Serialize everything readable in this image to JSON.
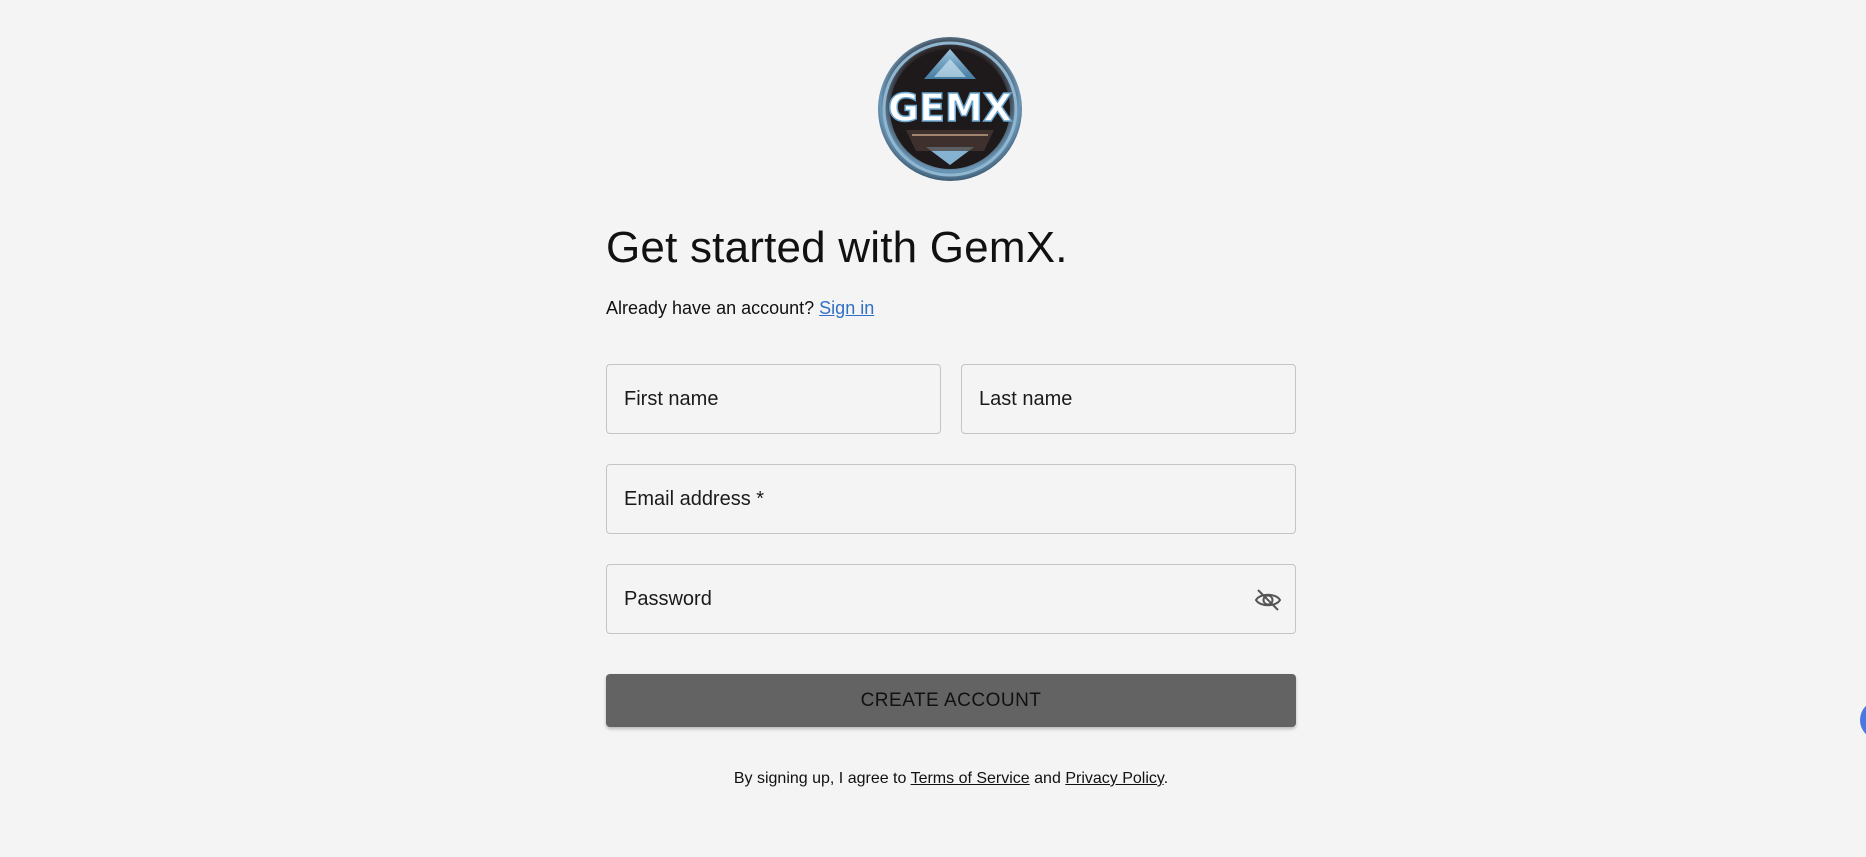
{
  "logo": {
    "text": "GEMX",
    "icon": "gemx-logo"
  },
  "heading": {
    "title": "Get started with GemX."
  },
  "signin": {
    "prompt": "Already have an account?",
    "link_label": "Sign in"
  },
  "form": {
    "first_name_placeholder": "First name",
    "last_name_placeholder": "Last name",
    "email_placeholder": "Email address *",
    "password_placeholder": "Password",
    "password_toggle_icon": "eye-off-icon",
    "submit_label": "CREATE ACCOUNT"
  },
  "legal": {
    "prefix": "By signing up, I agree to",
    "terms_label": "Terms of Service",
    "and": "and",
    "privacy_label": "Privacy Policy",
    "suffix": "."
  },
  "colors": {
    "background": "#f4f4f4",
    "link": "#2f6fc6",
    "button": "#636363",
    "chat_widget": "#4a78e0"
  }
}
